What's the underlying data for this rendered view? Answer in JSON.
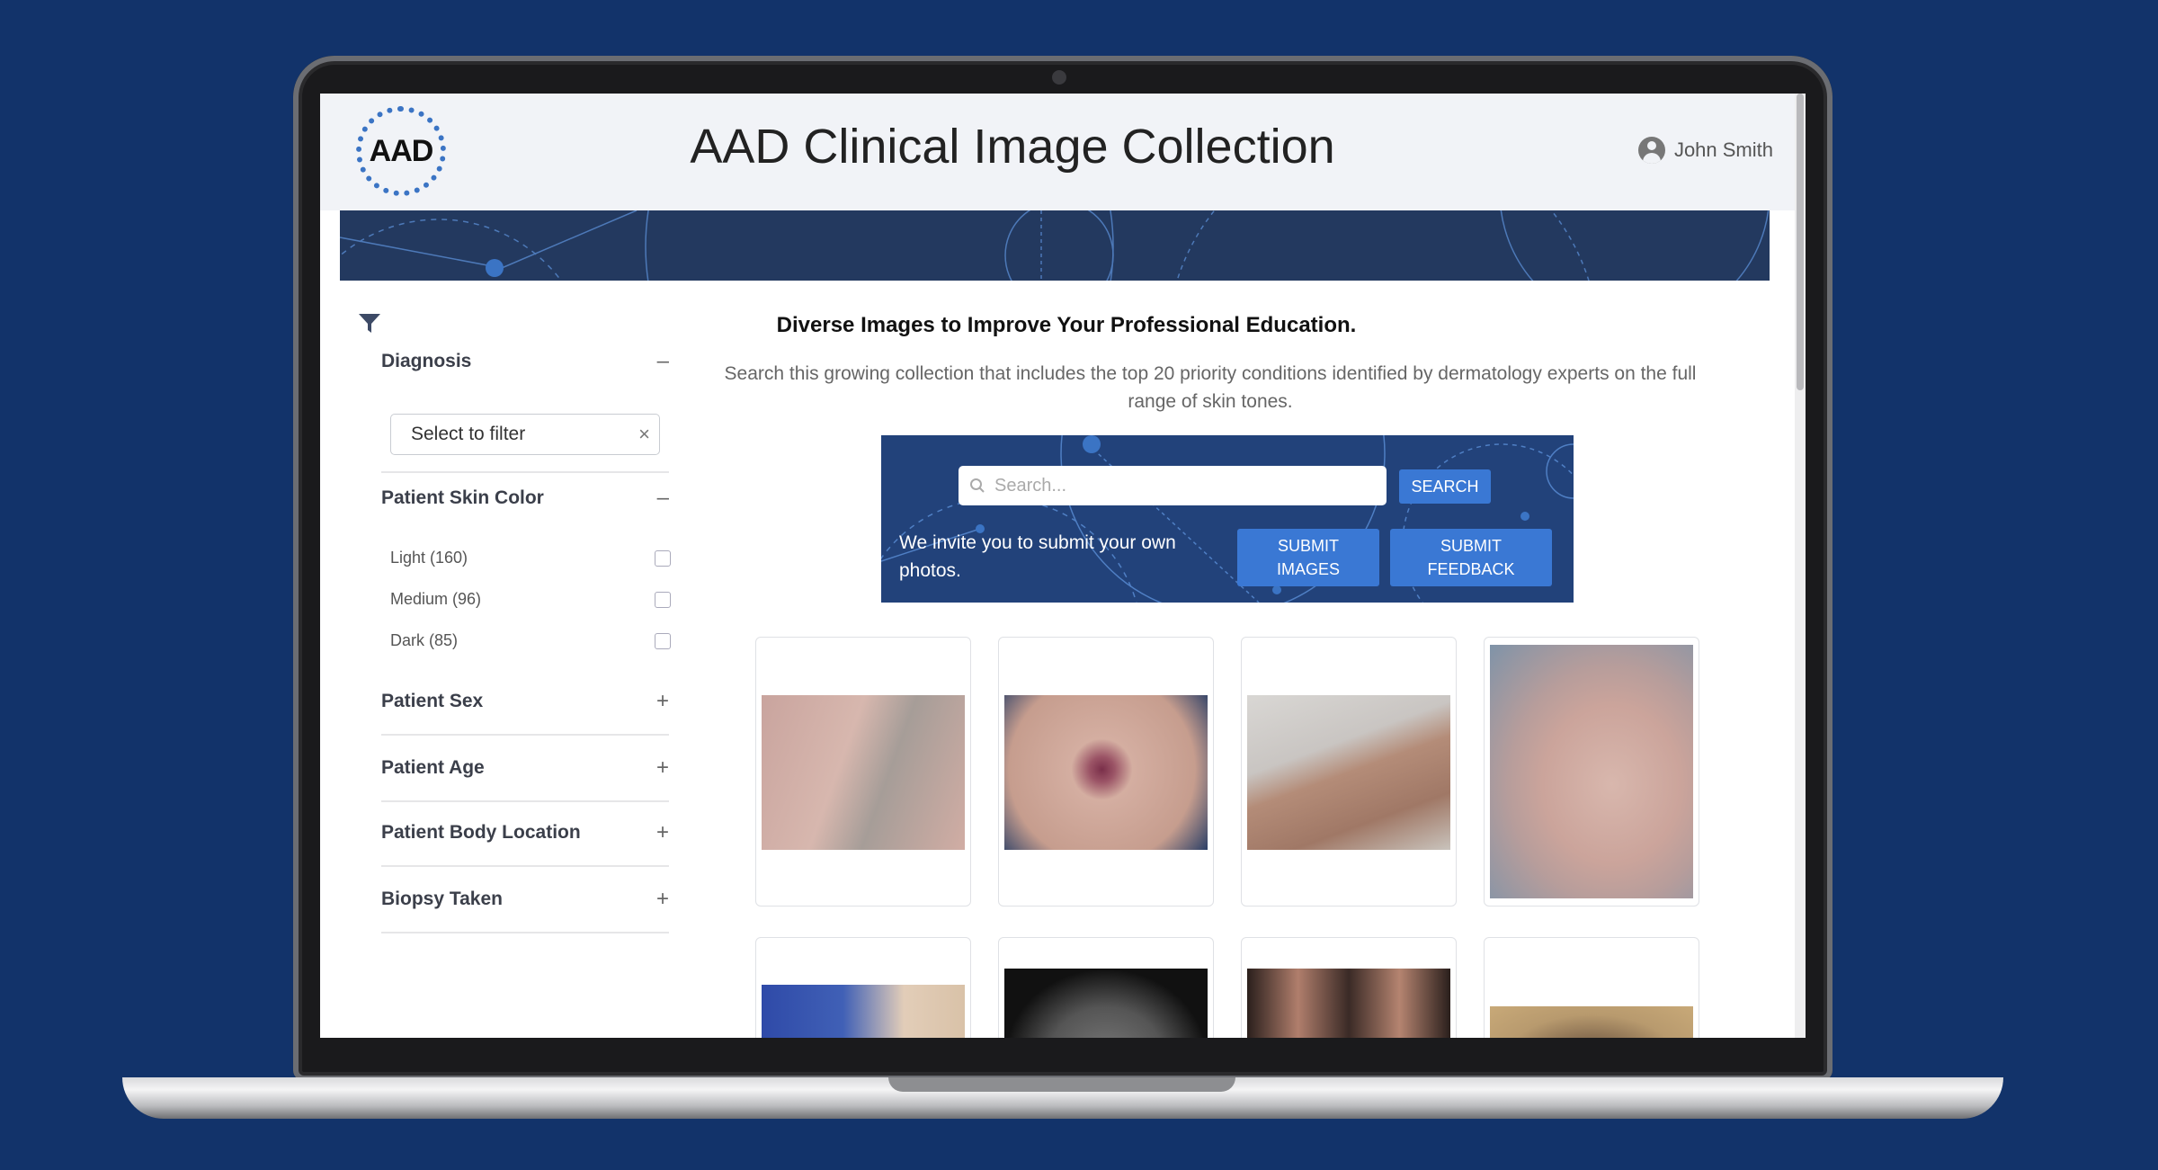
{
  "app": {
    "title": "AAD Clinical Image Collection",
    "logo_text": "AAD",
    "user_name": "John Smith"
  },
  "sidebar": {
    "facets": [
      {
        "label": "Diagnosis",
        "toggle": "–"
      },
      {
        "label": "Patient Skin Color",
        "toggle": "–"
      },
      {
        "label": "Patient Sex",
        "toggle": "+"
      },
      {
        "label": "Patient Age",
        "toggle": "+"
      },
      {
        "label": "Patient Body Location",
        "toggle": "+"
      },
      {
        "label": "Biopsy Taken",
        "toggle": "+"
      }
    ],
    "diagnosis_select": {
      "placeholder": "Select to filter",
      "clear": "×"
    },
    "skin_color_options": [
      {
        "label": "Light (160)",
        "checked": false
      },
      {
        "label": "Medium (96)",
        "checked": false
      },
      {
        "label": "Dark (85)",
        "checked": false
      }
    ]
  },
  "main": {
    "headline": "Diverse Images to Improve Your Professional Education.",
    "subtext": "Search this growing collection that includes the top 20 priority conditions identified by dermatology experts on the full range of skin tones.",
    "search": {
      "placeholder": "Search...",
      "button": "SEARCH"
    },
    "invite_text": "We invite you to submit your own photos.",
    "submit_images": "SUBMIT IMAGES",
    "submit_feedback": "SUBMIT FEEDBACK"
  },
  "colors": {
    "page_background": "#12336a",
    "banner": "#23395f",
    "search_panel": "#22427a",
    "button": "#3a78d4"
  },
  "icons": [
    "filter-icon",
    "user-icon",
    "search-icon",
    "close-icon"
  ]
}
